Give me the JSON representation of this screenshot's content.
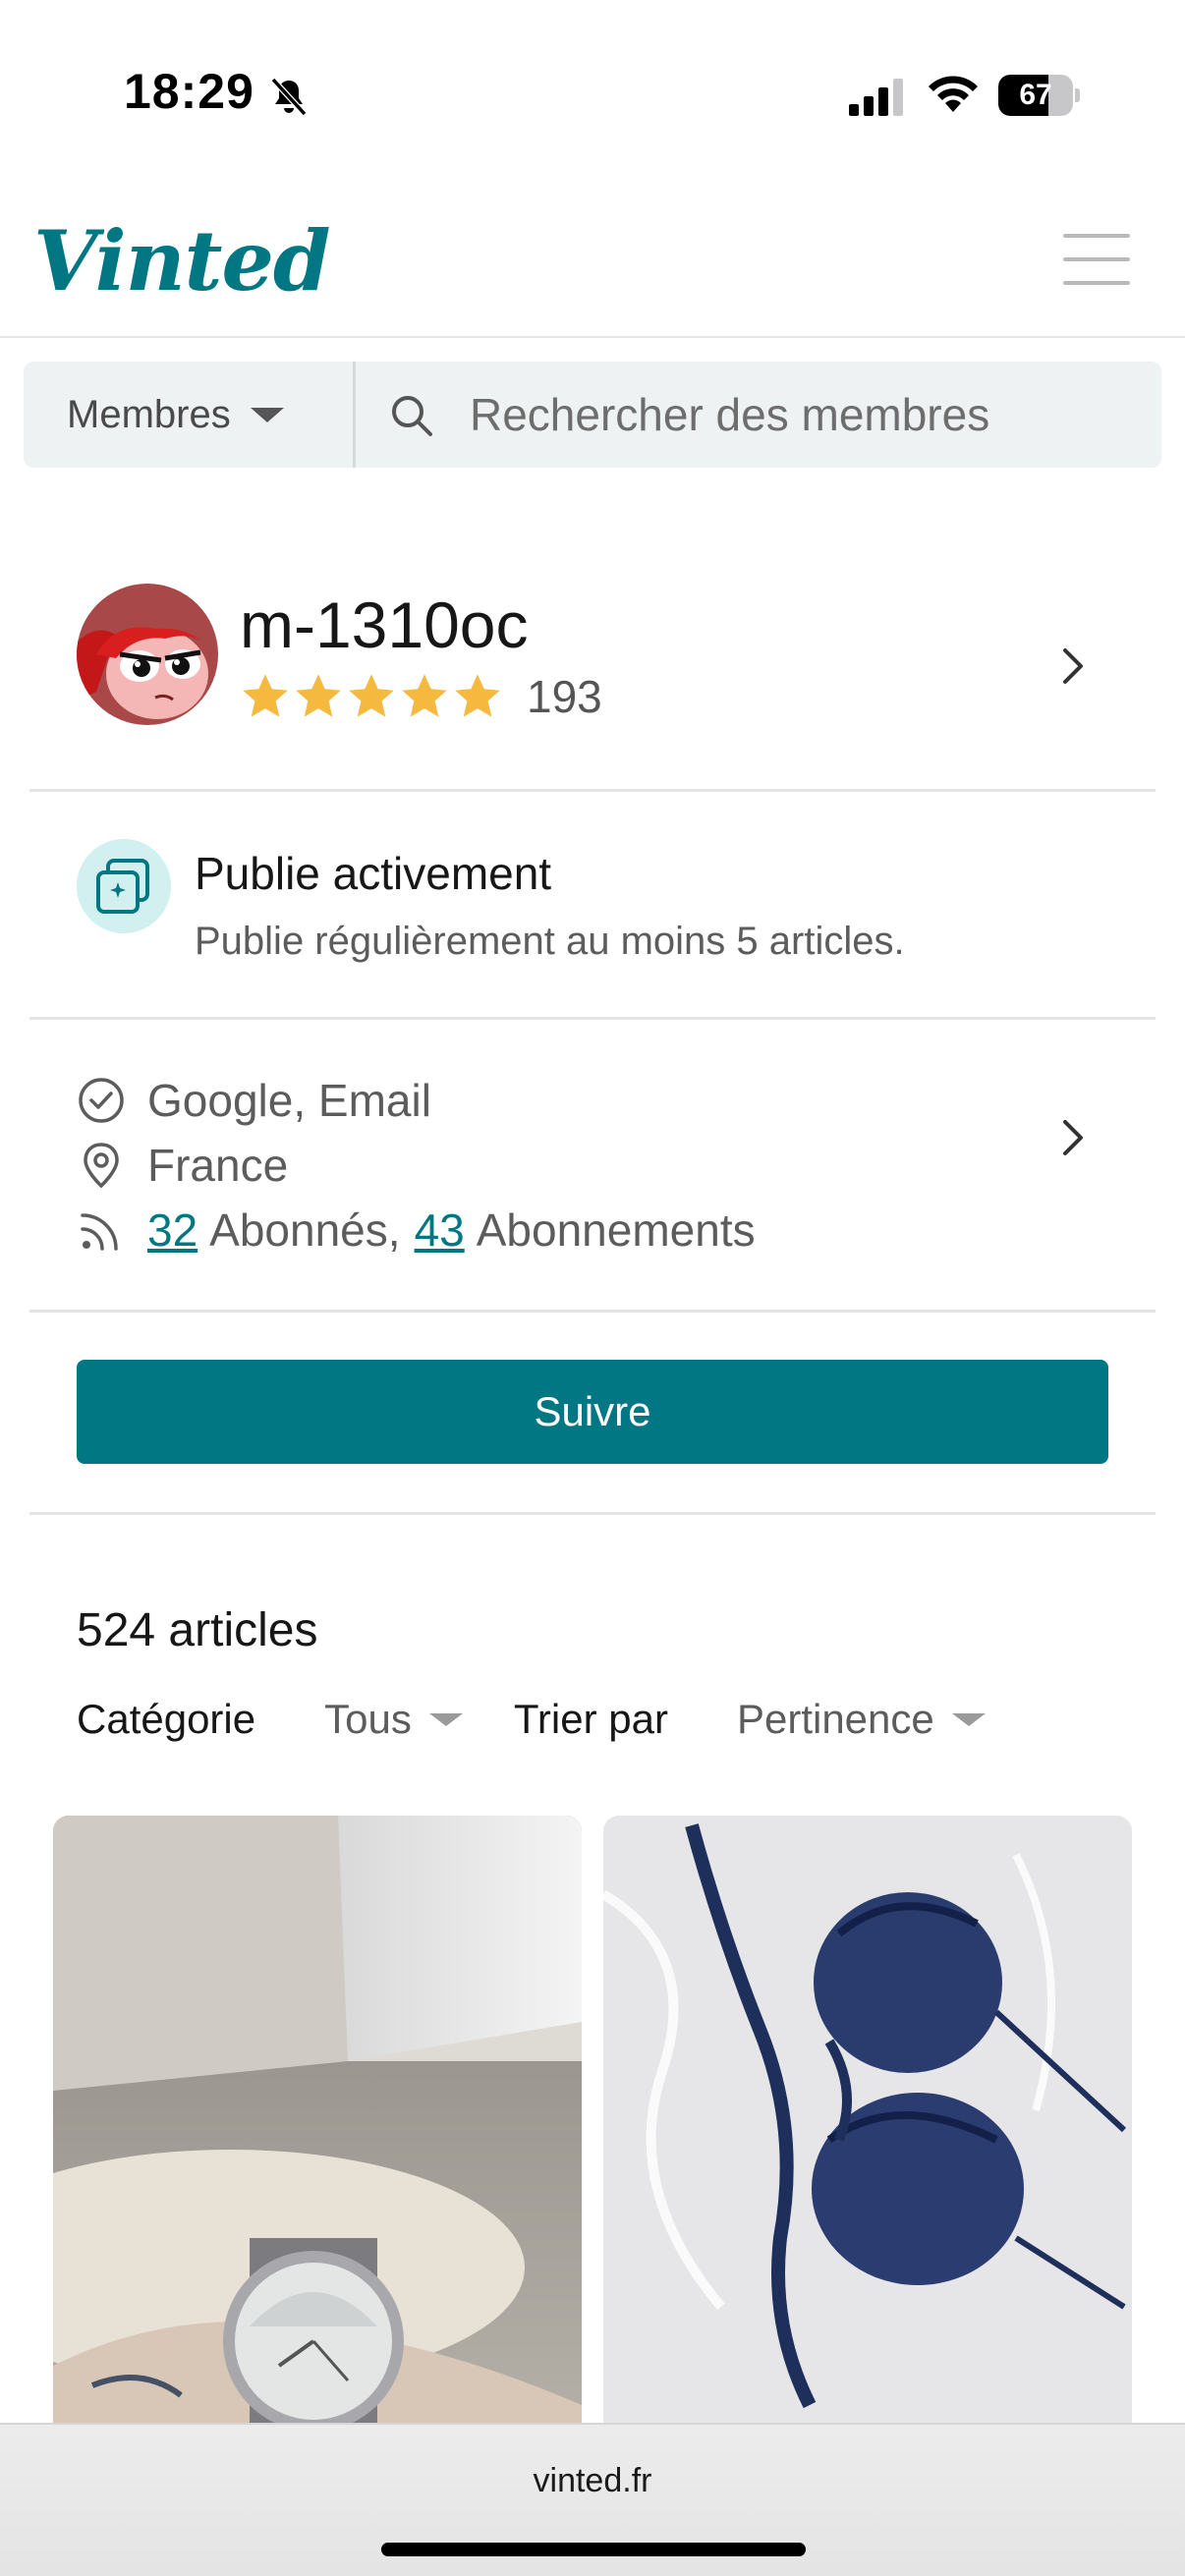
{
  "status_bar": {
    "time": "18:29",
    "battery_level": 67,
    "battery_label": "67",
    "icons": [
      "bell-muted-icon",
      "signal-icon",
      "wifi-icon",
      "battery-icon"
    ]
  },
  "header": {
    "logo": "Vinted",
    "menu_icon": "hamburger-menu-icon"
  },
  "search": {
    "type_label": "Membres",
    "placeholder": "Rechercher des membres",
    "value": ""
  },
  "profile": {
    "username": "m-1310oc",
    "rating_stars": 5,
    "review_count": "193"
  },
  "badge": {
    "title": "Publie activement",
    "description": "Publie régulièrement au moins 5 articles."
  },
  "info": {
    "verified": "Google, Email",
    "location": "France",
    "followers_count": "32",
    "followers_label": "Abonnés,",
    "following_count": "43",
    "following_label": "Abonnements"
  },
  "follow_button": "Suivre",
  "articles": {
    "count_label": "524 articles",
    "category_label": "Catégorie",
    "category_value": "Tous",
    "sort_label": "Trier par",
    "sort_value": "Pertinence",
    "items": [
      {
        "image": "wristwatch-photo"
      },
      {
        "image": "navy-lace-bra-photo"
      }
    ]
  },
  "browser": {
    "url": "vinted.fr"
  },
  "colors": {
    "brand": "#007782",
    "star": "#f6b940",
    "badge_bg": "#d2f0f0"
  }
}
